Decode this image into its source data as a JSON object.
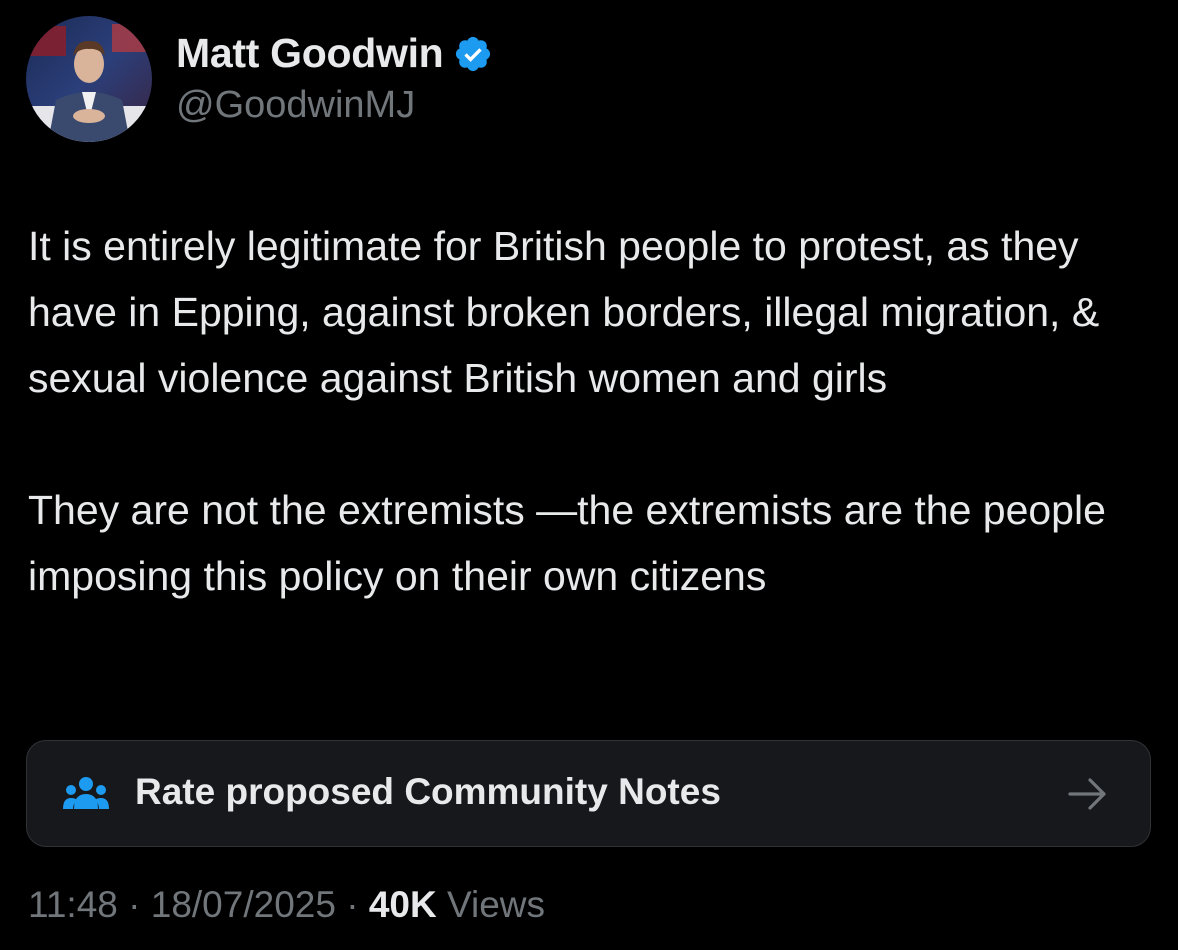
{
  "author": {
    "name": "Matt Goodwin",
    "handle": "@GoodwinMJ",
    "verified": true,
    "avatar_icon": "profile-photo"
  },
  "tweet": {
    "paragraphs": [
      "It is entirely legitimate for British people to protest, as they have in Epping, against broken borders, illegal migration, & sexual violence against British women and girls",
      "They are not the extremists —the extremists are the people imposing this policy on their own citizens"
    ]
  },
  "community_notes": {
    "label": "Rate proposed Community Notes",
    "icon": "people-group-icon",
    "arrow_icon": "arrow-right-icon",
    "icon_color": "#1d9bf0"
  },
  "meta": {
    "time": "11:48",
    "separator": "·",
    "date": "18/07/2025",
    "views_count": "40K",
    "views_label": "Views"
  },
  "colors": {
    "background": "#000000",
    "text_primary": "#e7e9ea",
    "text_secondary": "#71767b",
    "verified_badge": "#1d9bf0",
    "card_background": "#16181c",
    "card_border": "#2f3336"
  }
}
